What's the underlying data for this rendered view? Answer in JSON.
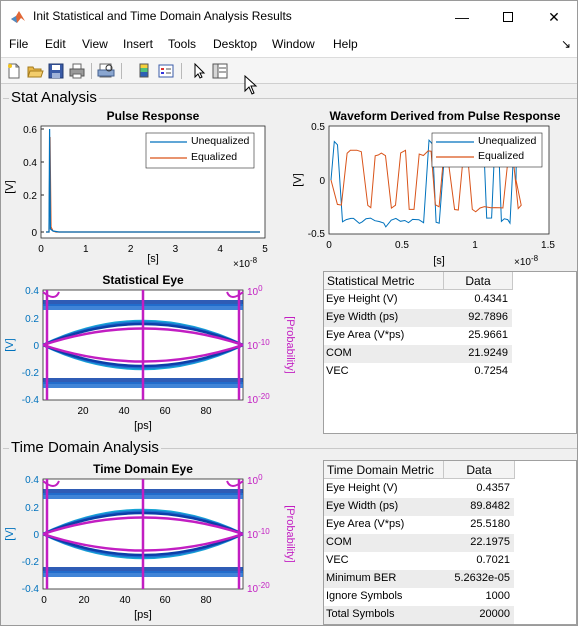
{
  "window": {
    "title": "Init Statistical and Time Domain Analysis Results"
  },
  "menu": [
    "File",
    "Edit",
    "View",
    "Insert",
    "Tools",
    "Desktop",
    "Window",
    "Help"
  ],
  "toolbar": {
    "icons": [
      "new-icon",
      "open-icon",
      "save-icon",
      "print-icon",
      "print-preview-icon",
      "colorbar-icon",
      "legend-icon",
      "pointer-icon",
      "property-editor-icon"
    ]
  },
  "stat_panel": {
    "title": "Stat Analysis",
    "table": {
      "header": [
        "Statistical Metric",
        "Data"
      ],
      "rows": [
        [
          "Eye Height (V)",
          "0.4341"
        ],
        [
          "Eye Width (ps)",
          "92.7896"
        ],
        [
          "Eye Area (V*ps)",
          "25.9661"
        ],
        [
          "COM",
          "21.9249"
        ],
        [
          "VEC",
          "0.7254"
        ]
      ]
    }
  },
  "time_panel": {
    "title": "Time Domain Analysis",
    "table": {
      "header": [
        "Time Domain Metric",
        "Data"
      ],
      "rows": [
        [
          "Eye Height (V)",
          "0.4357"
        ],
        [
          "Eye Width (ps)",
          "89.8482"
        ],
        [
          "Eye Area (V*ps)",
          "25.5180"
        ],
        [
          "COM",
          "22.1975"
        ],
        [
          "VEC",
          "0.7021"
        ],
        [
          "Minimum BER",
          "5.2632e-05"
        ],
        [
          "Ignore Symbols",
          "1000"
        ],
        [
          "Total Symbols",
          "20000"
        ]
      ]
    }
  },
  "chart_data": [
    {
      "type": "line",
      "title": "Pulse Response",
      "xlabel": "[s]",
      "ylabel": "[V]",
      "x_exponent": "×10⁻⁸",
      "xticks": [
        "0",
        "1",
        "2",
        "3",
        "4",
        "5"
      ],
      "yticks": [
        "0",
        "0.2",
        "0.4",
        "0.6"
      ],
      "legend": [
        "Unequalized",
        "Equalized"
      ],
      "colors": [
        "#0072bd",
        "#d95319"
      ]
    },
    {
      "type": "line",
      "title": "Waveform Derived from Pulse Response",
      "xlabel": "[s]",
      "ylabel": "[V]",
      "x_exponent": "×10⁻⁸",
      "xticks": [
        "0",
        "0.5",
        "1",
        "1.5"
      ],
      "yticks": [
        "-0.5",
        "0",
        "0.5"
      ],
      "legend": [
        "Unequalized",
        "Equalized"
      ],
      "colors": [
        "#0072bd",
        "#d95319"
      ]
    },
    {
      "type": "heatmap",
      "title": "Statistical Eye",
      "xlabel": "[ps]",
      "ylabel": "[V]",
      "ylabel_right": "[Probability]",
      "xticks": [
        "20",
        "40",
        "60",
        "80"
      ],
      "yticks": [
        "-0.4",
        "-0.2",
        "0",
        "0.2",
        "0.4"
      ],
      "yticks_right": [
        "10⁰",
        "10⁻¹⁰",
        "10⁻²⁰"
      ]
    },
    {
      "type": "heatmap",
      "title": "Time Domain Eye",
      "xlabel": "[ps]",
      "ylabel": "[V]",
      "ylabel_right": "[Probability]",
      "xticks": [
        "0",
        "20",
        "40",
        "60",
        "80"
      ],
      "yticks": [
        "-0.4",
        "-0.2",
        "0",
        "0.2",
        "0.4"
      ],
      "yticks_right": [
        "10⁰",
        "10⁻¹⁰",
        "10⁻²⁰"
      ]
    }
  ]
}
